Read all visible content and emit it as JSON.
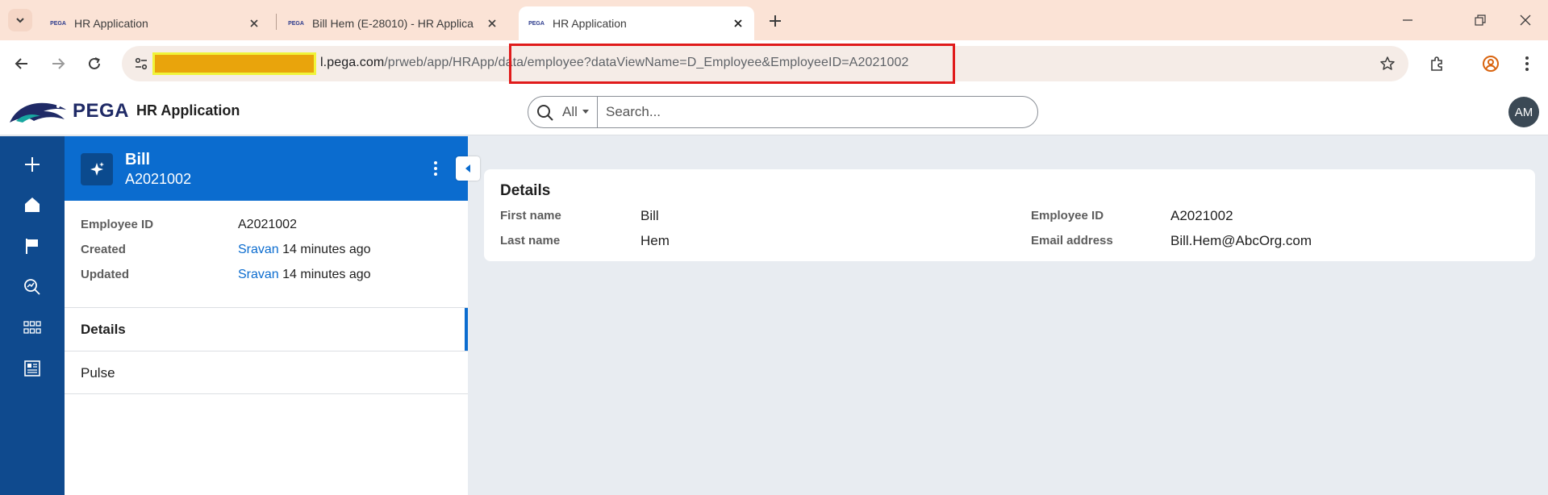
{
  "browser": {
    "tabs": [
      {
        "title": "HR Application",
        "favicon": "PEGA",
        "active": false
      },
      {
        "title": "Bill Hem (E-28010) - HR Applica",
        "favicon": "PEGA",
        "active": false
      },
      {
        "title": "HR Application",
        "favicon": "PEGA",
        "active": true
      }
    ],
    "url_host_suffix": "l.pega.com",
    "url_path": "/prweb/app/HRApp/data/employee?dataViewName=D_Employee&EmployeeID=A2021002",
    "annotations": {
      "redaction_color": "#e9a40c",
      "highlight_color": "#e01b1b"
    }
  },
  "app": {
    "logo_text": "PEGA",
    "title": "HR Application",
    "search": {
      "scope": "All",
      "placeholder": "Search..."
    },
    "avatar_initials": "AM"
  },
  "leftnav": {
    "icons": [
      "plus-icon",
      "home-icon",
      "flag-icon",
      "explore-icon",
      "apps-grid-icon",
      "report-icon"
    ]
  },
  "case": {
    "title": "Bill",
    "id": "A2021002",
    "summary": [
      {
        "label": "Employee ID",
        "value": "A2021002"
      },
      {
        "label": "Created",
        "user": "Sravan",
        "when": "14 minutes ago"
      },
      {
        "label": "Updated",
        "user": "Sravan",
        "when": "14 minutes ago"
      }
    ],
    "tabs": [
      {
        "label": "Details",
        "selected": true
      },
      {
        "label": "Pulse",
        "selected": false
      }
    ]
  },
  "details": {
    "title": "Details",
    "first_name_label": "First name",
    "first_name": "Bill",
    "last_name_label": "Last name",
    "last_name": "Hem",
    "employee_id_label": "Employee ID",
    "employee_id": "A2021002",
    "email_label": "Email address",
    "email": "Bill.Hem@AbcOrg.com"
  },
  "colors": {
    "nav": "#0f4a8e",
    "header": "#0b6ccf",
    "accent": "#0b6ccf"
  }
}
